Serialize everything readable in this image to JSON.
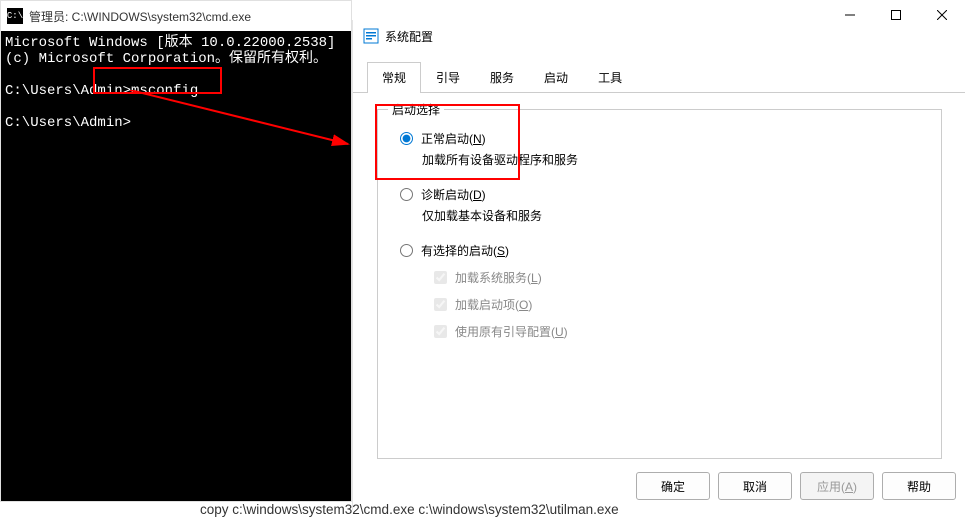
{
  "cmd": {
    "title": "管理员: C:\\WINDOWS\\system32\\cmd.exe",
    "line1": "Microsoft Windows [版本 10.0.22000.2538]",
    "line2": "(c) Microsoft Corporation。保留所有权利。",
    "prompt1_path": "C:\\Users\\Admin>",
    "prompt1_cmd": "msconfig",
    "prompt2": "C:\\Users\\Admin>"
  },
  "sysconfig": {
    "title": "系统配置",
    "tabs": {
      "general": "常规",
      "boot": "引导",
      "services": "服务",
      "startup": "启动",
      "tools": "工具"
    },
    "group_title": "启动选择",
    "normal": {
      "label_pre": "正常启动(",
      "hotkey": "N",
      "label_post": ")",
      "desc": "加载所有设备驱动程序和服务"
    },
    "diag": {
      "label_pre": "诊断启动(",
      "hotkey": "D",
      "label_post": ")",
      "desc": "仅加载基本设备和服务"
    },
    "selective": {
      "label_pre": "有选择的启动(",
      "hotkey": "S",
      "label_post": ")"
    },
    "chk_services": {
      "pre": "加载系统服务(",
      "hotkey": "L",
      "post": ")"
    },
    "chk_startup": {
      "pre": "加载启动项(",
      "hotkey": "O",
      "post": ")"
    },
    "chk_original": {
      "pre": "使用原有引导配置(",
      "hotkey": "U",
      "post": ")"
    },
    "buttons": {
      "ok": "确定",
      "cancel": "取消",
      "apply_pre": "应用(",
      "apply_hot": "A",
      "apply_post": ")",
      "help": "帮助"
    }
  },
  "bottom_text": "copy c:\\windows\\system32\\cmd.exe c:\\windows\\system32\\utilman.exe"
}
